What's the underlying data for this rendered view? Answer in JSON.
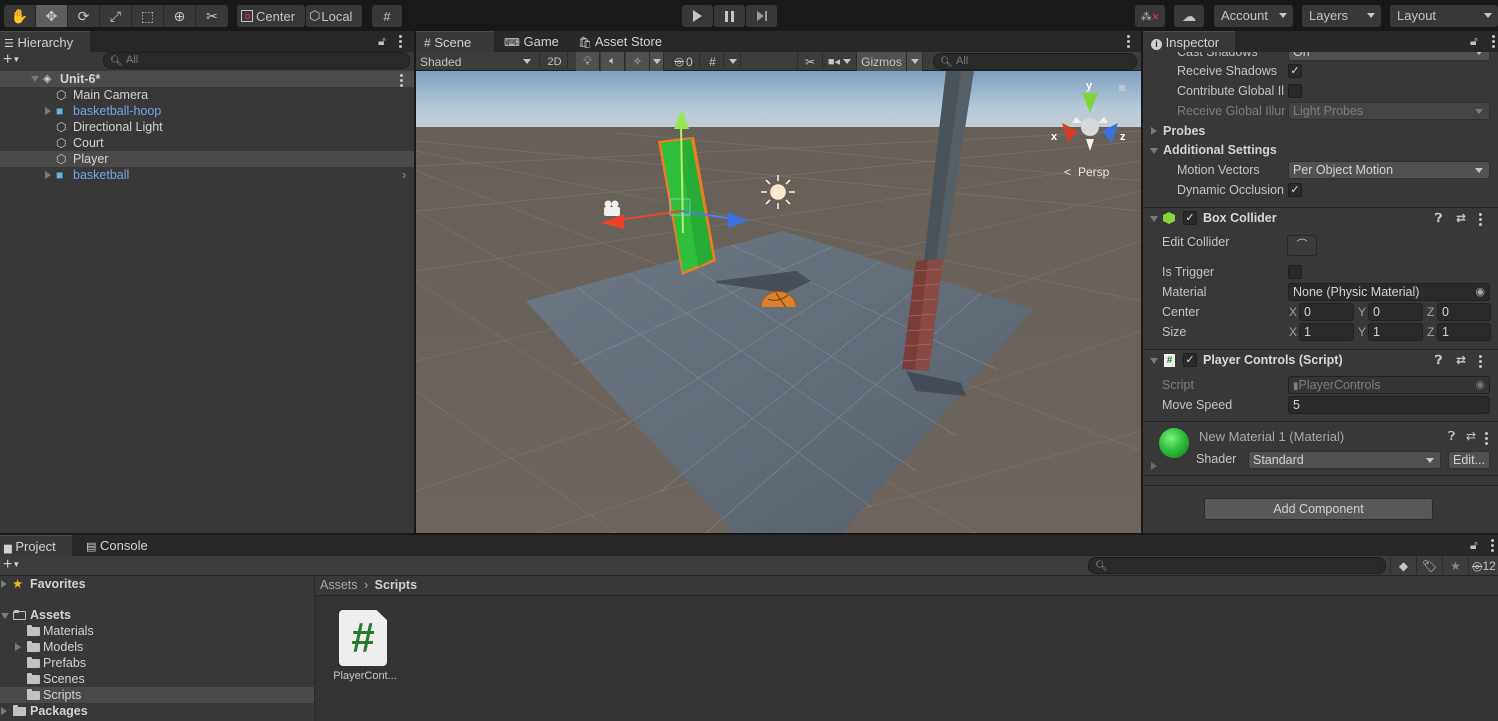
{
  "toolbar": {
    "tools": [
      "hand-tool",
      "move-tool",
      "rotate-tool",
      "scale-tool",
      "rect-tool",
      "transform-tool",
      "custom-tool"
    ],
    "active_tool": "move-tool",
    "pivot_label": "Center",
    "space_label": "Local",
    "account_label": "Account",
    "layers_label": "Layers",
    "layout_label": "Layout"
  },
  "hierarchy": {
    "tab_label": "Hierarchy",
    "search_placeholder": "All",
    "scene_name": "Unit-6*",
    "items": [
      {
        "label": "Main Camera",
        "prefab": false,
        "expandable": false
      },
      {
        "label": "basketball-hoop",
        "prefab": true,
        "expandable": true
      },
      {
        "label": "Directional Light",
        "prefab": false,
        "expandable": false
      },
      {
        "label": "Court",
        "prefab": false,
        "expandable": false
      },
      {
        "label": "Player",
        "prefab": false,
        "expandable": false,
        "selected": true
      },
      {
        "label": "basketball",
        "prefab": true,
        "expandable": true
      }
    ]
  },
  "scene": {
    "tabs": [
      {
        "label": "Scene",
        "icon": "grid-icon",
        "active": true
      },
      {
        "label": "Game",
        "icon": "gamepad-icon",
        "active": false
      },
      {
        "label": "Asset Store",
        "icon": "shopping-bag-icon",
        "active": false
      }
    ],
    "draw_mode": "Shaded",
    "mode_2d": "2D",
    "hidden_count": "0",
    "gizmos_label": "Gizmos",
    "search_placeholder": "All",
    "persp_label": "Persp",
    "axis_labels": {
      "x": "x",
      "y": "y",
      "z": "z"
    }
  },
  "inspector": {
    "tab_label": "Inspector",
    "cast_shadows": {
      "label": "Cast Shadows",
      "value": "On"
    },
    "receive_shadows": {
      "label": "Receive Shadows",
      "checked": true
    },
    "contribute_gi": {
      "label": "Contribute Global Il",
      "checked": false
    },
    "receive_gi": {
      "label": "Receive Global Illur",
      "value": "Light Probes"
    },
    "probes_label": "Probes",
    "additional_label": "Additional Settings",
    "motion_vectors": {
      "label": "Motion Vectors",
      "value": "Per Object Motion"
    },
    "dynamic_occlusion": {
      "label": "Dynamic Occlusion",
      "checked": true
    },
    "box_collider": {
      "title": "Box Collider",
      "enabled": true,
      "edit_collider_label": "Edit Collider",
      "is_trigger_label": "Is Trigger",
      "is_trigger": false,
      "material_label": "Material",
      "material_value": "None (Physic Material)",
      "center_label": "Center",
      "center": {
        "x": "0",
        "y": "0",
        "z": "0"
      },
      "size_label": "Size",
      "size": {
        "x": "1",
        "y": "1",
        "z": "1"
      }
    },
    "player_controls": {
      "title": "Player Controls (Script)",
      "enabled": true,
      "script_label": "Script",
      "script_value": "PlayerControls",
      "move_speed_label": "Move Speed",
      "move_speed": "5"
    },
    "material": {
      "title": "New Material 1 (Material)",
      "shader_label": "Shader",
      "shader_value": "Standard",
      "edit_label": "Edit...",
      "color": "#2fbf3c"
    },
    "add_component_label": "Add Component"
  },
  "project": {
    "tabs": [
      {
        "label": "Project",
        "active": true
      },
      {
        "label": "Console",
        "active": false
      }
    ],
    "hidden_count": "12",
    "tree": [
      {
        "label": "Favorites",
        "level": 0,
        "icon": "star-icon",
        "bold": true
      },
      {
        "label": "Assets",
        "level": 0,
        "icon": "folder-open-icon",
        "bold": true,
        "open": true
      },
      {
        "label": "Materials",
        "level": 1
      },
      {
        "label": "Models",
        "level": 1,
        "expandable": true
      },
      {
        "label": "Prefabs",
        "level": 1
      },
      {
        "label": "Scenes",
        "level": 1
      },
      {
        "label": "Scripts",
        "level": 1,
        "selected": true
      },
      {
        "label": "Packages",
        "level": 0,
        "bold": true
      }
    ],
    "breadcrumb": [
      "Assets",
      "Scripts"
    ],
    "assets": [
      {
        "label": "PlayerCont...",
        "type": "csharp-script"
      }
    ]
  }
}
